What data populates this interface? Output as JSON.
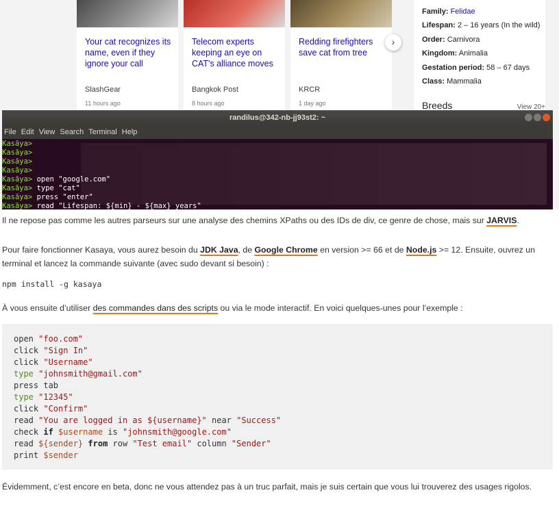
{
  "news_cards": [
    {
      "title": "Your cat recognizes its name, even if they ignore your call",
      "source": "SlashGear",
      "time": "11 hours ago",
      "img_color": "#6b6b6b"
    },
    {
      "title": "Telecom experts keeping an eye on CAT's alliance moves",
      "source": "Bangkok Post",
      "time": "8 hours ago",
      "img_color": "#c84a3c"
    },
    {
      "title": "Redding firefighters save cat from tree",
      "source": "KRCR",
      "time": "1 day ago",
      "img_color": "#8a7a55"
    }
  ],
  "next_icon": "chevron-right-icon",
  "knowledge_panel": {
    "rows": [
      {
        "label": "Family:",
        "value": "Felidae",
        "link": true
      },
      {
        "label": "Lifespan:",
        "value": "2 – 16 years (In the wild)",
        "link": false
      },
      {
        "label": "Order:",
        "value": "Carnivora",
        "link": false
      },
      {
        "label": "Kingdom:",
        "value": "Animalia",
        "link": false
      },
      {
        "label": "Gestation period:",
        "value": "58 – 67 days",
        "link": false
      },
      {
        "label": "Class:",
        "value": "Mammalia",
        "link": false
      }
    ],
    "breeds_heading": "Breeds",
    "view_more": "View 20+"
  },
  "terminal": {
    "title": "randilus@342-nb-jj93st2: ~",
    "menu": [
      "File",
      "Edit",
      "View",
      "Search",
      "Terminal",
      "Help"
    ],
    "prompt": "Kasaya>",
    "lines": [
      {
        "prompt": "Kasāya>",
        "cmd": ""
      },
      {
        "prompt": "Kasāya>",
        "cmd": ""
      },
      {
        "prompt": "Kasāya>",
        "cmd": ""
      },
      {
        "prompt": "Kasāya>",
        "cmd": ""
      },
      {
        "prompt": "Kasāya>",
        "cmd": " open \"google.com\""
      },
      {
        "prompt": "Kasāya>",
        "cmd": " type \"cat\""
      },
      {
        "prompt": "Kasāya>",
        "cmd": " press \"enter\""
      },
      {
        "prompt": "Kasāya>",
        "cmd": " read \"Lifespan: ${min} - ${max} years\""
      }
    ]
  },
  "article": {
    "p1_before": "Il ne repose pas comme les autres parseurs sur une analyse des chemins XPaths ou des IDs de div, ce genre de chose, mais sur ",
    "p1_link": "JARVIS",
    "p1_after": ".",
    "p2_a": "Pour faire fonctionner Kasaya, vous aurez besoin du ",
    "p2_link1": "JDK Java",
    "p2_b": ", de ",
    "p2_link2": "Google Chrome",
    "p2_c": " en version >= 66 et de ",
    "p2_link3": "Node.js",
    "p2_d": " >= 12. Ensuite, ouvrez un terminal et lancez la commande suivante (avec sudo devant si besoin) :",
    "install_cmd": "npm install -g kasaya",
    "p3_a": "À vous ensuite d’utiliser ",
    "p3_link": "des commandes dans des scripts",
    "p3_b": " ou via le mode interactif. En voici quelques-unes pour l’exemple :",
    "p4": "Évidemment, c’est encore en beta, donc ne vous attendez pas à un truc parfait, mais je suis certain que vous lui trouverez des usages rigolos."
  },
  "code_lines": [
    [
      [
        "t",
        "open "
      ],
      [
        "s",
        "\"foo.com\""
      ]
    ],
    [
      [
        "t",
        "click "
      ],
      [
        "s",
        "\"Sign In\""
      ]
    ],
    [
      [
        "t",
        "click "
      ],
      [
        "s",
        "\"Username\""
      ]
    ],
    [
      [
        "g",
        "type "
      ],
      [
        "s",
        "\"johnsmith@gmail.com\""
      ]
    ],
    [
      [
        "t",
        "press tab"
      ]
    ],
    [
      [
        "g",
        "type "
      ],
      [
        "s",
        "\"12345\""
      ]
    ],
    [
      [
        "t",
        "click "
      ],
      [
        "s",
        "\"Confirm\""
      ]
    ],
    [
      [
        "t",
        "read "
      ],
      [
        "s",
        "\"You are logged in as ${username}\""
      ],
      [
        "t",
        " near "
      ],
      [
        "s",
        "\"Success\""
      ]
    ],
    [
      [
        "t",
        "check "
      ],
      [
        "b",
        "if"
      ],
      [
        "t",
        " "
      ],
      [
        "v",
        "$username"
      ],
      [
        "t",
        " is "
      ],
      [
        "s",
        "\"johnsmith@google.com\""
      ]
    ],
    [
      [
        "t",
        "read "
      ],
      [
        "v",
        "${sender}"
      ],
      [
        "t",
        " "
      ],
      [
        "b",
        "from"
      ],
      [
        "t",
        " row "
      ],
      [
        "s",
        "\"Test email\""
      ],
      [
        "t",
        " column "
      ],
      [
        "s",
        "\"Sender\""
      ]
    ],
    [
      [
        "t",
        "print "
      ],
      [
        "v",
        "$sender"
      ]
    ]
  ]
}
